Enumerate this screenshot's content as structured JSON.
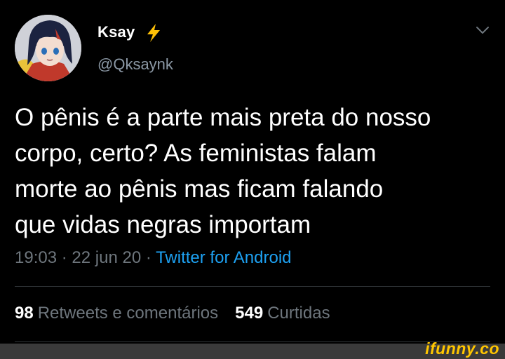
{
  "user": {
    "display_name": "Ksay",
    "handle": "@Qksaynk"
  },
  "tweet": {
    "text": "O pênis é a parte mais preta do nosso\ncorpo, certo? As feministas falam\nmorte ao pênis mas ficam falando\nque vidas negras importam",
    "time": "19:03",
    "separator": "·",
    "date": "22 jun 20",
    "source": "Twitter for Android"
  },
  "stats": {
    "retweets_count": "98",
    "retweets_label": "Retweets e comentários",
    "likes_count": "549",
    "likes_label": "Curtidas"
  },
  "watermark": "ifunny.co",
  "icons": {
    "verified_bolt": "lightning-bolt-icon",
    "menu": "chevron-down-icon"
  },
  "colors": {
    "background": "#000000",
    "link": "#1da1f2",
    "muted": "#6e767d",
    "bolt": "#ffc107",
    "watermark": "#ffc600"
  }
}
